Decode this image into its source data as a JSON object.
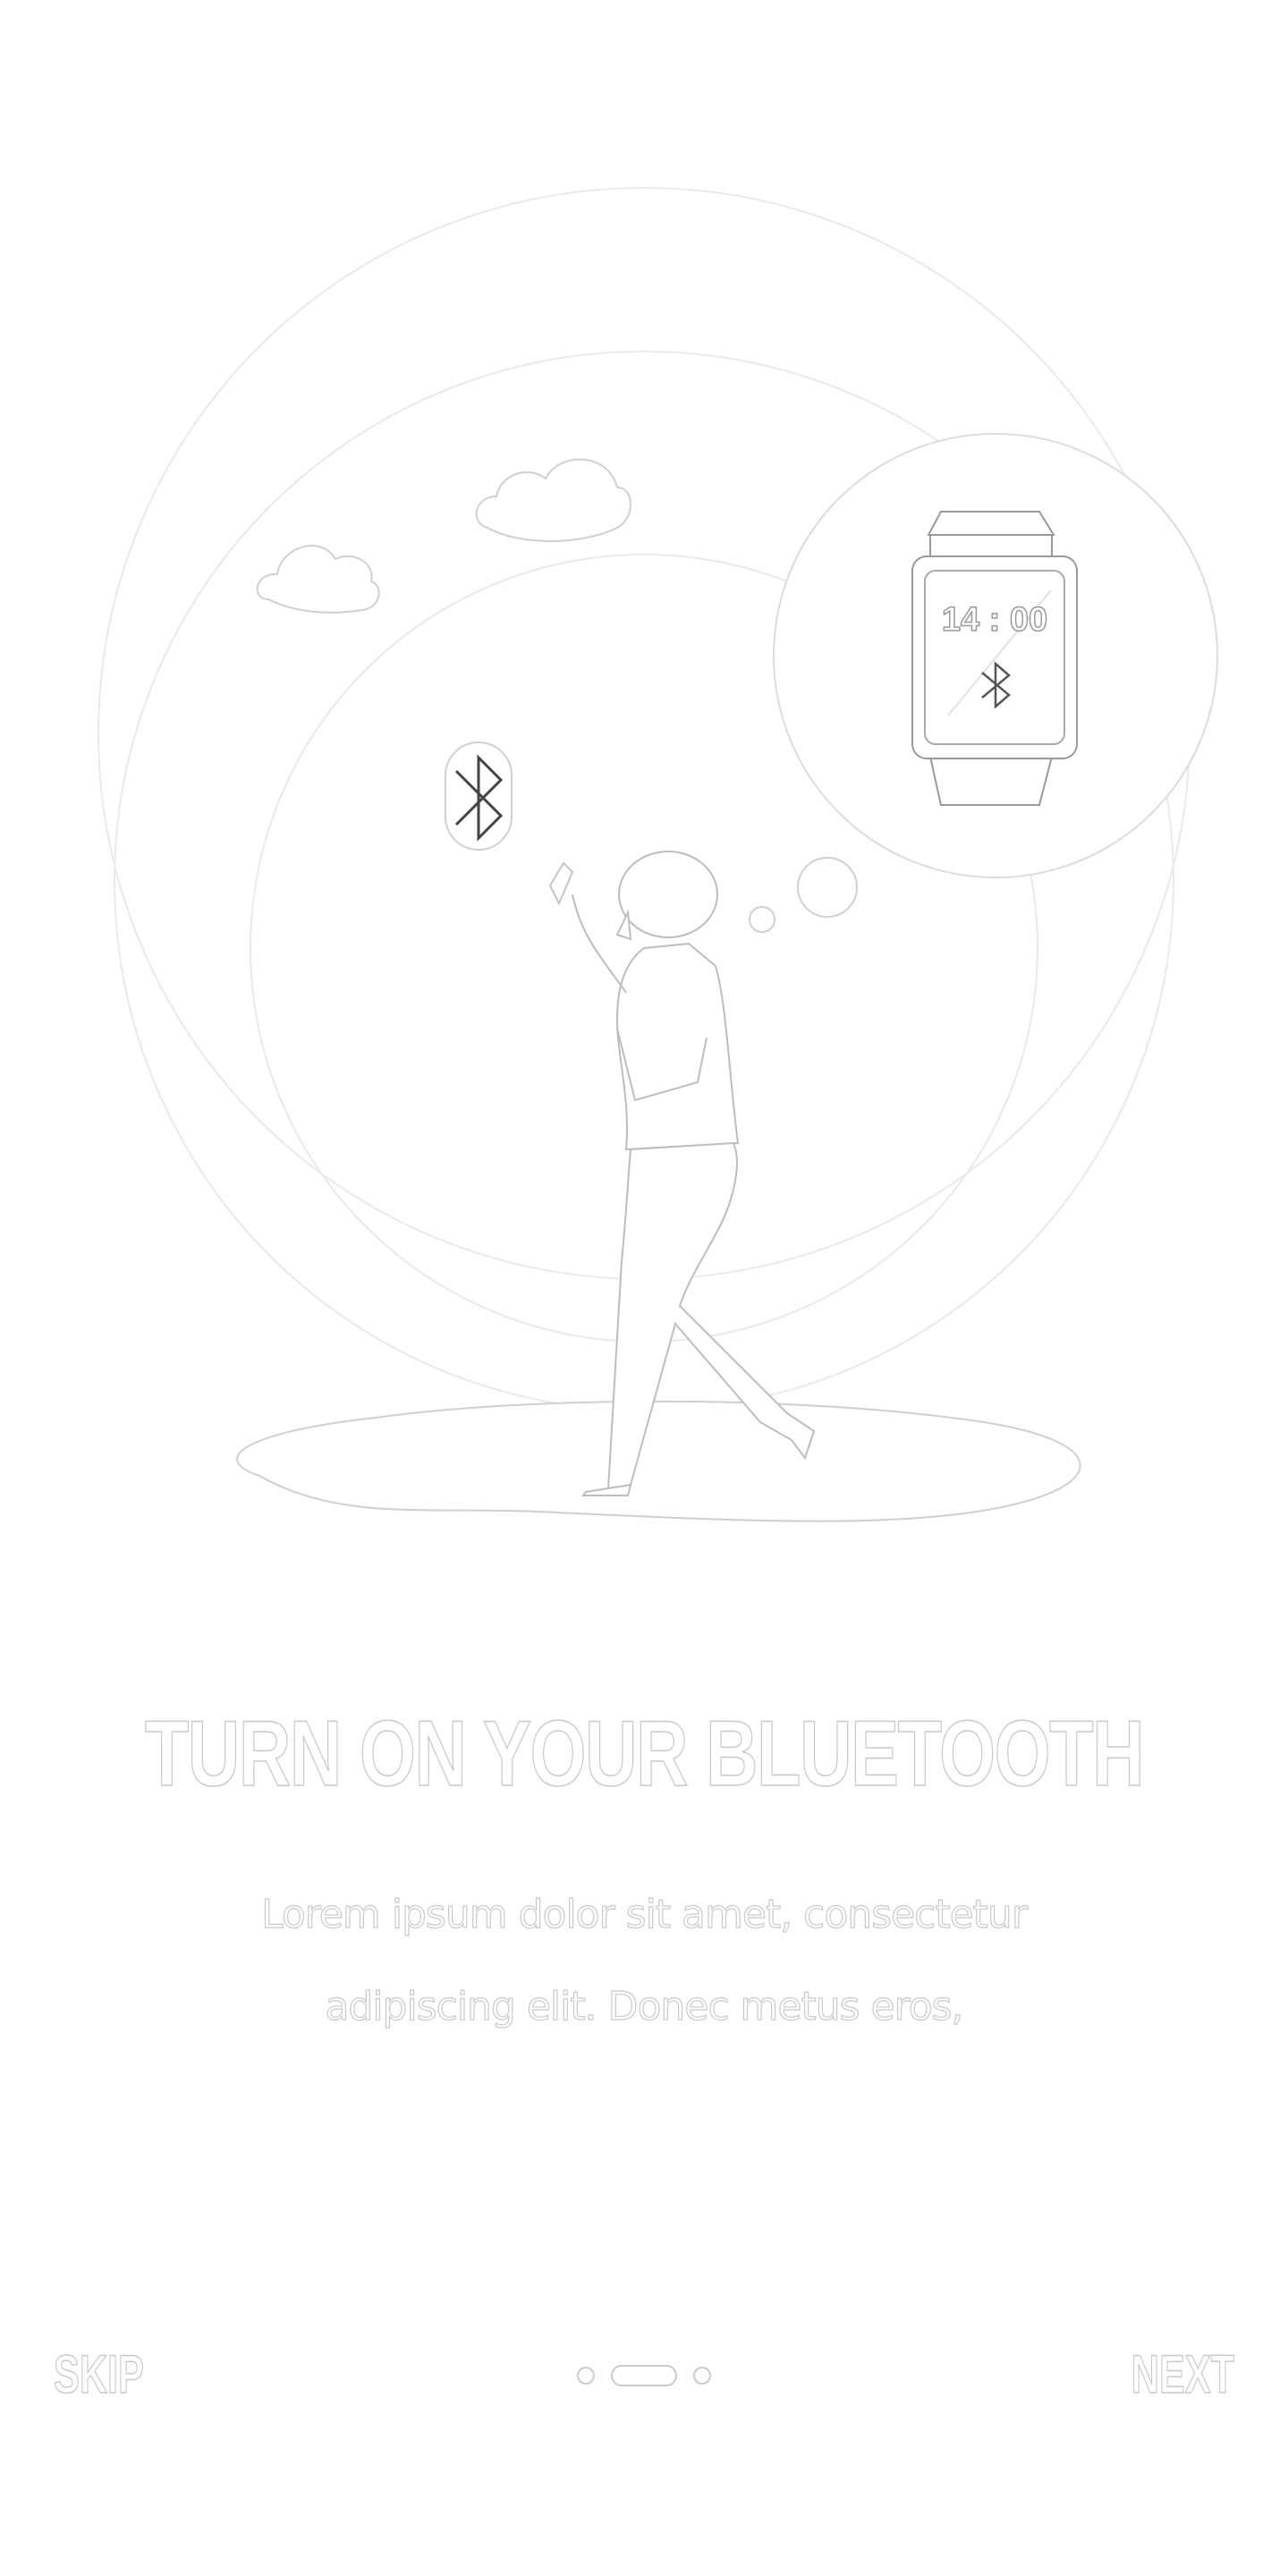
{
  "screen": {
    "title": "TURN ON YOUR BLUETOOTH",
    "description_line1": "Lorem ipsum dolor sit amet, consectetur",
    "description_line2": "adipiscing elit. Donec metus eros,"
  },
  "watch": {
    "time": "14 : 00"
  },
  "footer": {
    "skip_label": "SKIP",
    "next_label": "NEXT",
    "page_index": 1,
    "page_count": 3
  },
  "icons": [
    "bluetooth-icon",
    "smartwatch-icon",
    "cloud-icon"
  ],
  "colors": {
    "outline": "#c9c9c9",
    "background": "#ffffff"
  }
}
